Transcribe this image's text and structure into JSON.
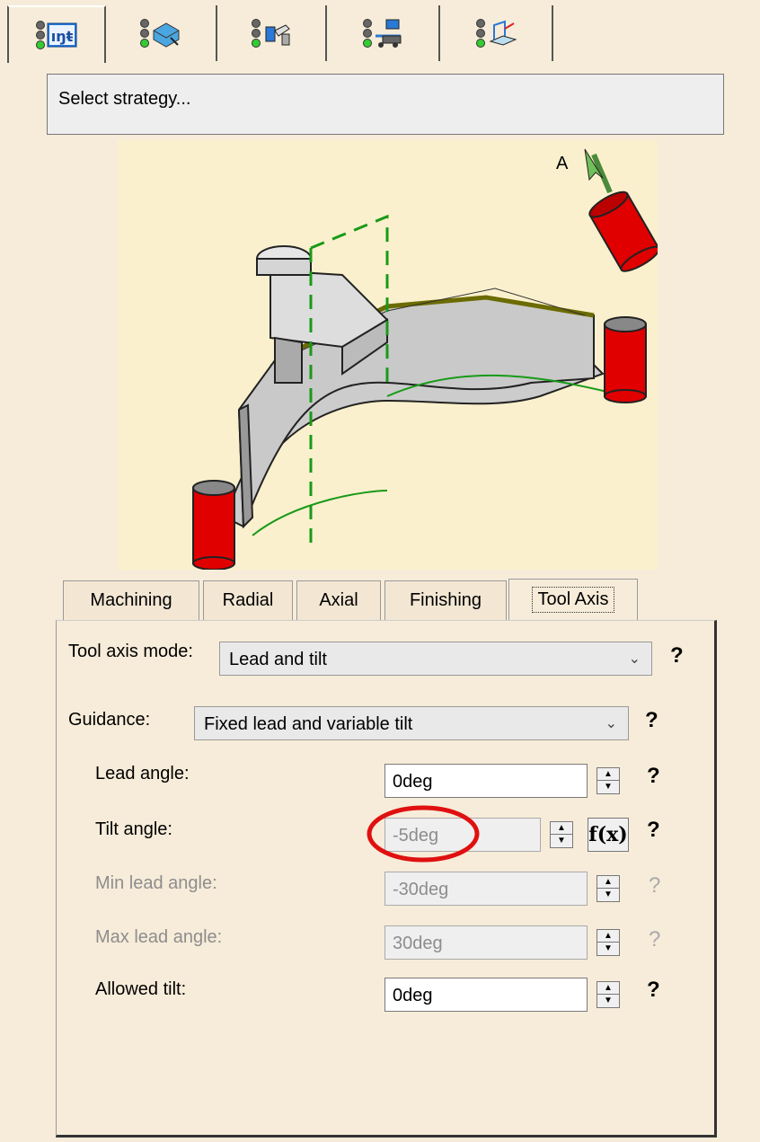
{
  "toolbar": {
    "tabs": [
      {
        "icon": "strategy-parameters-icon",
        "active": true
      },
      {
        "icon": "geometry-icon",
        "active": false
      },
      {
        "icon": "tool-icon",
        "active": false
      },
      {
        "icon": "feeds-speeds-icon",
        "active": false
      },
      {
        "icon": "macros-icon",
        "active": false
      }
    ]
  },
  "message": "Select strategy...",
  "tabs": [
    "Machining",
    "Radial",
    "Axial",
    "Finishing",
    "Tool Axis"
  ],
  "active_tab": "Tool Axis",
  "form": {
    "tool_axis_mode": {
      "label": "Tool axis mode:",
      "value": "Lead and tilt"
    },
    "guidance": {
      "label": "Guidance:",
      "value": "Fixed lead and variable tilt"
    },
    "lead_angle": {
      "label": "Lead angle:",
      "value": "0deg"
    },
    "tilt_angle": {
      "label": "Tilt angle:",
      "value": "-5deg"
    },
    "min_lead_angle": {
      "label": "Min lead angle:",
      "value": "-30deg"
    },
    "max_lead_angle": {
      "label": "Max lead angle:",
      "value": "30deg"
    },
    "allowed_tilt": {
      "label": "Allowed tilt:",
      "value": "0deg"
    }
  },
  "help_glyph": "?",
  "fx_label": "f(x)",
  "illustration_axis_label": "A",
  "colors": {
    "background": "#f7ecd9",
    "illustration_bg": "#fbf0cd",
    "highlight": "#e01010",
    "tool_red": "#e00000"
  }
}
